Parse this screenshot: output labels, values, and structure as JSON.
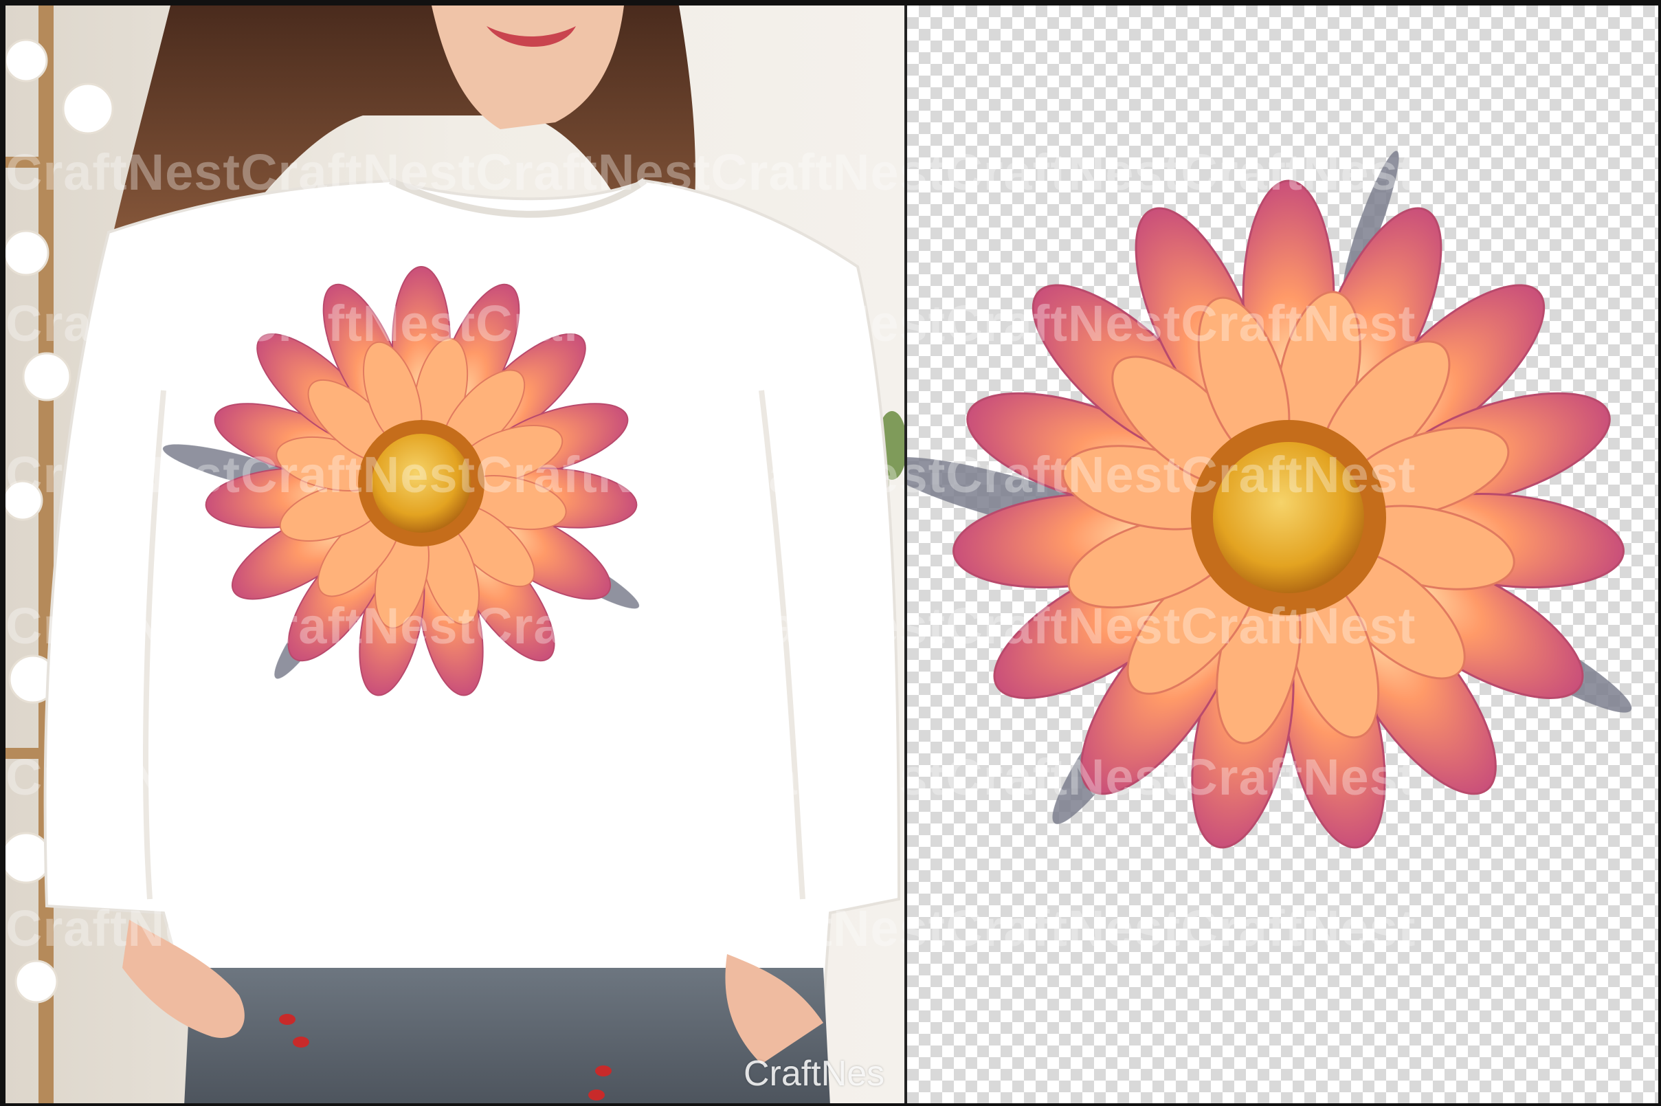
{
  "watermark": {
    "text": "CraftNest",
    "repeated_line": "CraftNestCraftNestCraftNestCraftNestCraftNestCraftNest"
  },
  "caption": {
    "text": "CraftNes"
  },
  "colors": {
    "petal_outer": "#c94f7a",
    "petal_inner": "#ff9a68",
    "petal_tip_light": "#ffe6b3",
    "center_core": "#e3a321",
    "center_ring": "#c56d1b",
    "leaf": "#7c7f8e",
    "sweater": "#ffffff",
    "checker_gray": "#d9d9d9"
  }
}
